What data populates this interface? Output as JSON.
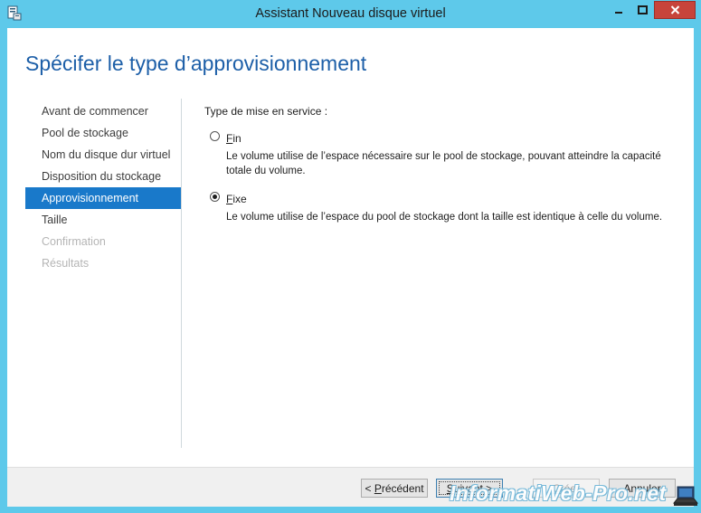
{
  "window": {
    "title": "Assistant Nouveau disque virtuel",
    "heading": "Spécifer le type d’approvisionnement"
  },
  "nav": {
    "items": [
      {
        "label": "Avant de commencer",
        "state": "normal"
      },
      {
        "label": "Pool de stockage",
        "state": "normal"
      },
      {
        "label": "Nom du disque dur virtuel",
        "state": "normal"
      },
      {
        "label": "Disposition du stockage",
        "state": "normal"
      },
      {
        "label": "Approvisionnement",
        "state": "selected"
      },
      {
        "label": "Taille",
        "state": "normal"
      },
      {
        "label": "Confirmation",
        "state": "disabled"
      },
      {
        "label": "Résultats",
        "state": "disabled"
      }
    ]
  },
  "content": {
    "section_label": "Type de mise en service :",
    "options": [
      {
        "hotkey": "F",
        "rest": "in",
        "description": "Le volume utilise de l’espace nécessaire sur le pool de stockage, pouvant atteindre la capacité totale du volume.",
        "checked": false
      },
      {
        "hotkey": "F",
        "rest": "ixe",
        "description": "Le volume utilise de l’espace du pool de stockage dont la taille est identique à celle du volume.",
        "checked": true
      }
    ]
  },
  "footer": {
    "prev_prefix": "< ",
    "prev_hotkey": "P",
    "prev_rest": "récédent",
    "next_hotkey": "S",
    "next_rest": "uivant >",
    "create_hotkey": "C",
    "create_rest": "réer",
    "cancel_label": "Annuler"
  },
  "watermark": "InformatiWeb-Pro.net",
  "colors": {
    "titlebar": "#5ec9ea",
    "heading": "#1d5fa8",
    "selected_nav": "#1979ca",
    "close_button": "#c7443b"
  }
}
